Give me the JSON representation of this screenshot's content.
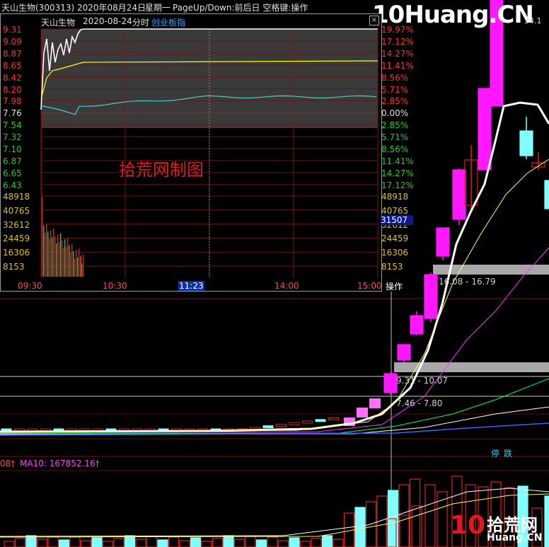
{
  "topbar": {
    "stock": "天山生物(300313)",
    "date": "2020年08月24日",
    "weekday": "星期一",
    "hint": "PageUp/Down:前后日 空格键:操作",
    "brand": "10Huang.CN"
  },
  "popup": {
    "name": "天山生物",
    "date": "2020-08-24",
    "mode": "分时",
    "board": "创业板指",
    "close_icon": "close-icon",
    "price_labels": [
      "9.31",
      "9.09",
      "8.87",
      "8.65",
      "8.42",
      "8.20",
      "7.98",
      "7.76",
      "7.54",
      "7.32",
      "7.10",
      "6.87",
      "6.65",
      "6.43"
    ],
    "pct_labels": [
      "19.97%",
      "17.12%",
      "14.27%",
      "11.41%",
      "8.56%",
      "5.71%",
      "2.85%",
      "0.00%",
      "2.85%",
      "5.71%",
      "8.56%",
      "11.41%",
      "14.27%",
      "17.12%"
    ],
    "vol_labels": [
      "48918",
      "40765",
      "32612",
      "24459",
      "16306",
      "8153"
    ],
    "vol_cursor": "31507",
    "time_labels": [
      "09:30",
      "10:30",
      "11:23",
      "14:00",
      "15:00"
    ],
    "cursor_time": "11:23",
    "op_button": "操作",
    "watermark": "拾荒网制图",
    "colors": {
      "up": "#e2181f",
      "down": "#00c0c0",
      "price": "#ffffff",
      "avg": "#ffff00"
    }
  },
  "main": {
    "ranges": [
      {
        "label": "16.08 - 16.79"
      },
      {
        "label": "9.31 - 10.07"
      },
      {
        "label": "7.46 - 7.80"
      }
    ],
    "partial_price": "34.1",
    "limit_tags": [
      "停",
      "跌"
    ],
    "ma_text": "08†",
    "ma10_text": "MA10: 167852.16†",
    "colors": {
      "up": "#ff18ff",
      "down": "#7fffff",
      "ma5": "#ffffff",
      "ma10": "#ffff66",
      "ma20": "#ff33ff",
      "ma60": "#00ff66"
    }
  },
  "logo": {
    "num": "10",
    "cn": "拾荒网",
    "url": "Huang.CN"
  }
}
